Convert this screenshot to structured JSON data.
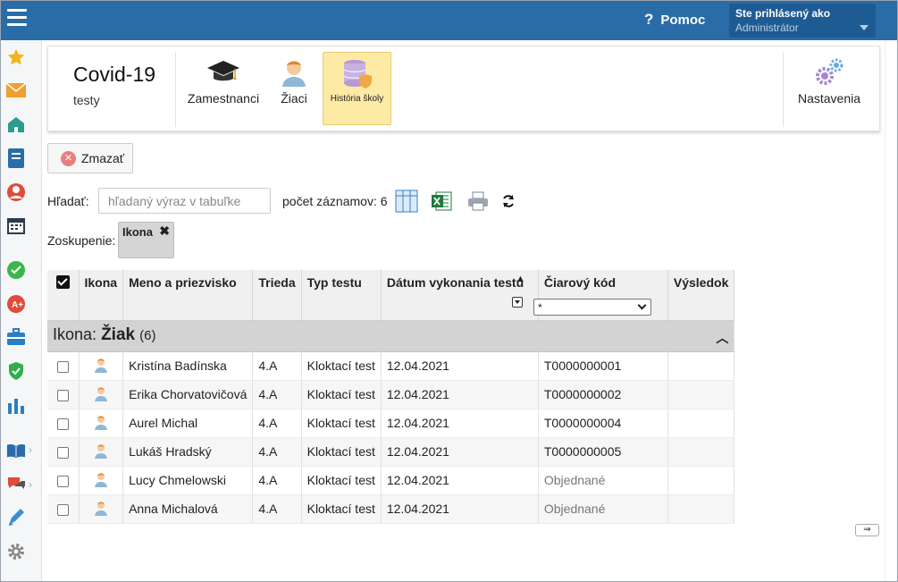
{
  "topbar": {
    "help_label": "Pomoc",
    "user_line1": "Ste prihlásený ako",
    "user_line2": "Administrátor"
  },
  "sidebar": {
    "items": [
      {
        "icon": "star-icon"
      },
      {
        "icon": "mail-icon"
      },
      {
        "icon": "school-icon"
      },
      {
        "icon": "notebook-icon"
      },
      {
        "icon": "person-icon"
      },
      {
        "icon": "calendar-icon"
      },
      {
        "icon": "check-circle-icon"
      },
      {
        "icon": "grade-icon"
      },
      {
        "icon": "briefcase-icon"
      },
      {
        "icon": "shield-check-icon"
      },
      {
        "icon": "bar-chart-icon"
      },
      {
        "icon": "book-icon"
      },
      {
        "icon": "chat-icon"
      },
      {
        "icon": "pen-icon"
      },
      {
        "icon": "gear-icon"
      }
    ]
  },
  "module_bar": {
    "title": "Covid-19",
    "subtitle": "testy",
    "modules": [
      {
        "label": "Zamestnanci",
        "icon": "graduation-cap-icon"
      },
      {
        "label": "Žiaci",
        "icon": "student-icon"
      },
      {
        "label": "História školy",
        "icon": "database-shield-icon",
        "active": true
      },
      {
        "label": "Nastavenia",
        "icon": "gears-icon"
      }
    ]
  },
  "toolbar": {
    "delete_label": "Zmazať",
    "search_label": "Hľadať:",
    "search_placeholder": "hľadaný výraz v tabuľke",
    "record_count": "počet záznamov: 6",
    "grouping_label": "Zoskupenie:",
    "group_chip": "Ikona"
  },
  "table": {
    "columns": [
      "Ikona",
      "Meno a priezvisko",
      "Trieda",
      "Typ testu",
      "Dátum vykonania testu",
      "Čiarový kód",
      "Výsledok"
    ],
    "barcode_filter": "*",
    "group": {
      "prefix": "Ikona:",
      "name": "Žiak",
      "count": "(6)"
    },
    "rows": [
      {
        "name": "Kristína Badínska",
        "class": "4.A",
        "type": "Kloktací test",
        "date": "12.04.2021",
        "code": "T0000000001",
        "result": ""
      },
      {
        "name": "Erika Chorvatovičová",
        "class": "4.A",
        "type": "Kloktací test",
        "date": "12.04.2021",
        "code": "T0000000002",
        "result": ""
      },
      {
        "name": "Aurel Michal",
        "class": "4.A",
        "type": "Kloktací test",
        "date": "12.04.2021",
        "code": "T0000000004",
        "result": ""
      },
      {
        "name": "Lukáš Hradský",
        "class": "4.A",
        "type": "Kloktací test",
        "date": "12.04.2021",
        "code": "T0000000005",
        "result": ""
      },
      {
        "name": "Lucy Chmelowski",
        "class": "4.A",
        "type": "Kloktací test",
        "date": "12.04.2021",
        "code": "Objednané",
        "result": ""
      },
      {
        "name": "Anna Michalová",
        "class": "4.A",
        "type": "Kloktací test",
        "date": "12.04.2021",
        "code": "Objednané",
        "result": ""
      }
    ]
  },
  "colors": {
    "topbar": "#2a6ca8",
    "active_module": "#fdeaa5",
    "group_row": "#d3d3d3"
  }
}
